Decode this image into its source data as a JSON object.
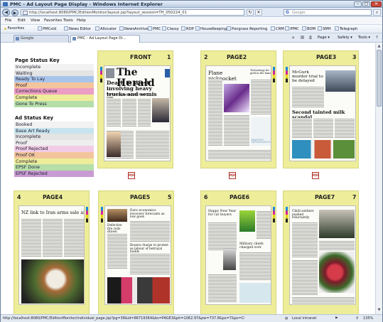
{
  "window": {
    "title": "PMC - Ad Layout Page Display - Windows Internet Explorer",
    "min": "–",
    "max": "□",
    "close": "✕"
  },
  "address": {
    "url": "http://localhost:8080/PMC/EditionMonitor/layout.jsp?layout_session=TH_050224_01",
    "back_icon": "◀",
    "fwd_icon": "▶",
    "refresh_icon": "↻",
    "stop_icon": "✕",
    "search_logo": "G",
    "search_placeholder": "Google"
  },
  "menu": [
    "File",
    "Edit",
    "View",
    "Favorites",
    "Tools",
    "Help"
  ],
  "favorites_bar": {
    "favorites_label": "Favorites",
    "links": [
      "PMCold",
      "News Editor",
      "Allocator",
      "NewsArchive",
      "PMC",
      "Classy",
      "ROP",
      "HouseKeeping",
      "Pongrass Reporting",
      "CRM",
      "IPMC",
      "BOM",
      "SMH",
      "Telegraph"
    ]
  },
  "tabs": [
    {
      "label": "Google",
      "active": false
    },
    {
      "label": "PMC - Ad Layout Page Di...",
      "active": true
    }
  ],
  "toolbar": {
    "page": "Page",
    "safety": "Safety",
    "tools": "Tools",
    "help_icon": "?"
  },
  "page_status_key": {
    "title": "Page Status Key",
    "items": [
      {
        "label": "Incomplete",
        "color": "#f2f2f2"
      },
      {
        "label": "Waiting",
        "color": "#e4e4e4"
      },
      {
        "label": "Ready To Lay",
        "color": "#a9c4ea"
      },
      {
        "label": "Proof",
        "color": "#f3c59c"
      },
      {
        "label": "Corrections Queue",
        "color": "#ec9dc4"
      },
      {
        "label": "Complete",
        "color": "#eeed9a"
      },
      {
        "label": "Gone To Press",
        "color": "#b6dea9"
      }
    ]
  },
  "ad_status_key": {
    "title": "Ad Status Key",
    "items": [
      {
        "label": "Booked",
        "color": "#f2f2f2"
      },
      {
        "label": "Base Art Ready",
        "color": "#c7e4ef"
      },
      {
        "label": "Incomplete",
        "color": "#e4e4e4"
      },
      {
        "label": "Proof",
        "color": "#eeeeee"
      },
      {
        "label": "Proof Rejected",
        "color": "#f2cce6"
      },
      {
        "label": "Proof OK",
        "color": "#f3c59c"
      },
      {
        "label": "Complete",
        "color": "#eeed9a"
      },
      {
        "label": "EPSF Done",
        "color": "#b6dea9"
      },
      {
        "label": "EPSF Rejected",
        "color": "#c99bd3"
      }
    ]
  },
  "pages": [
    {
      "name": "FRONT",
      "number": "1",
      "masthead": "The Herald",
      "headline": "Death is latest involving heavy trucks and semis",
      "subhead": "Teen SMS caught in the living room"
    },
    {
      "name": "PAGE2",
      "number": "2",
      "headline": "Plane pickpocket",
      "side_headline": "Technology for gold in the hand",
      "ad_text": "TRAINING ORGANISATION"
    },
    {
      "name": "PAGE3",
      "number": "3",
      "headline": "McGurk murder trial to be delayed",
      "headline2": "Second tainted milk scandal"
    },
    {
      "name": "PAGE4",
      "number": "4",
      "headline": "NZ link to Iran arms sale al-"
    },
    {
      "name": "PAGE5",
      "number": "5",
      "headline": "Euro economics recovery forecasts as low goes",
      "headline2": "Defective fire rods drawn",
      "headline3": "Bosses charge to protest as labour of betrayal builds"
    },
    {
      "name": "PAGE6",
      "number": "6",
      "headline": "Happy New Year for car buyers",
      "headline2": "Military chiefs charged over"
    },
    {
      "name": "PAGE7",
      "number": "7",
      "headline": "Child soldiers pushed reluctantly"
    }
  ],
  "pdf_icon_text": "PDF",
  "status": {
    "link": "http://localhost:8080/PMC/EditionMonitor/individual_page.jsp?pg=38&id=86719364&bs=PAGE3&ph=1062.97&pw=737.8&ps=7&ps=COMPLETE",
    "zone": "Local intranet",
    "zoom": "135%"
  }
}
